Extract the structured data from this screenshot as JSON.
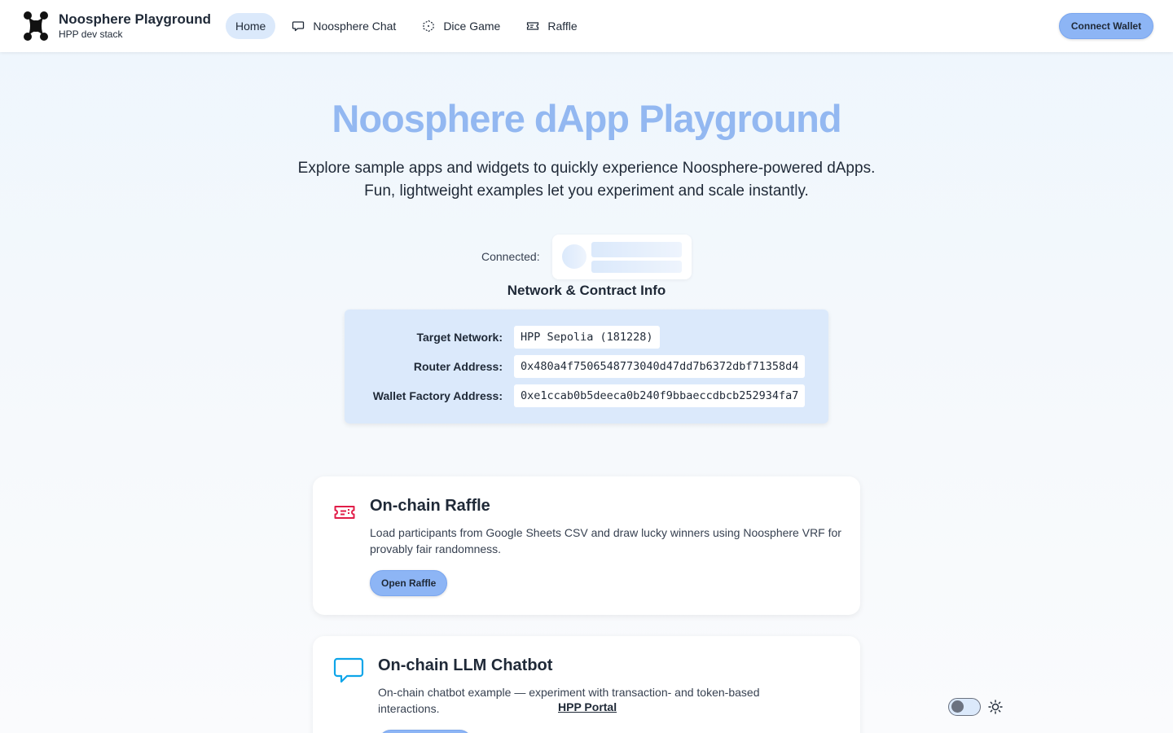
{
  "header": {
    "brand_title": "Noosphere Playground",
    "brand_subtitle": "HPP dev stack",
    "nav": [
      {
        "label": "Home",
        "icon": "none",
        "active": true
      },
      {
        "label": "Noosphere Chat",
        "icon": "chat-bubble-icon",
        "active": false
      },
      {
        "label": "Dice Game",
        "icon": "dice-icon",
        "active": false
      },
      {
        "label": "Raffle",
        "icon": "ticket-icon",
        "active": false
      }
    ],
    "connect_label": "Connect Wallet"
  },
  "hero": {
    "title": "Noosphere dApp Playground",
    "line1": "Explore sample apps and widgets to quickly experience Noosphere-powered dApps.",
    "line2": "Fun, lightweight examples let you experiment and scale instantly."
  },
  "connection": {
    "label": "Connected:"
  },
  "network": {
    "heading": "Network & Contract Info",
    "rows": [
      {
        "label": "Target Network:",
        "value": "HPP Sepolia (181228)"
      },
      {
        "label": "Router Address:",
        "value": "0x480a4f7506548773040d47dd7b6372dbf71358d4"
      },
      {
        "label": "Wallet Factory Address:",
        "value": "0xe1ccab0b5deeca0b240f9bbaeccdbcb252934fa7"
      }
    ]
  },
  "cards": [
    {
      "title": "On-chain Raffle",
      "description": "Load participants from Google Sheets CSV and draw lucky winners using Noosphere VRF for provably fair randomness.",
      "button": "Open Raffle",
      "icon": "ticket-icon"
    },
    {
      "title": "On-chain LLM Chatbot",
      "description": "On-chain chatbot example — experiment with transaction- and token-based interactions.",
      "button": "",
      "icon": "chat-bubble-icon"
    }
  ],
  "footer": {
    "portal_link": "HPP Portal"
  },
  "colors": {
    "accent": "#8db5f5",
    "hero_title": "#93b8f1",
    "network_box": "#dbe9fb",
    "raffle_icon": "#e11d48",
    "chat_icon": "#0ea5e9"
  }
}
